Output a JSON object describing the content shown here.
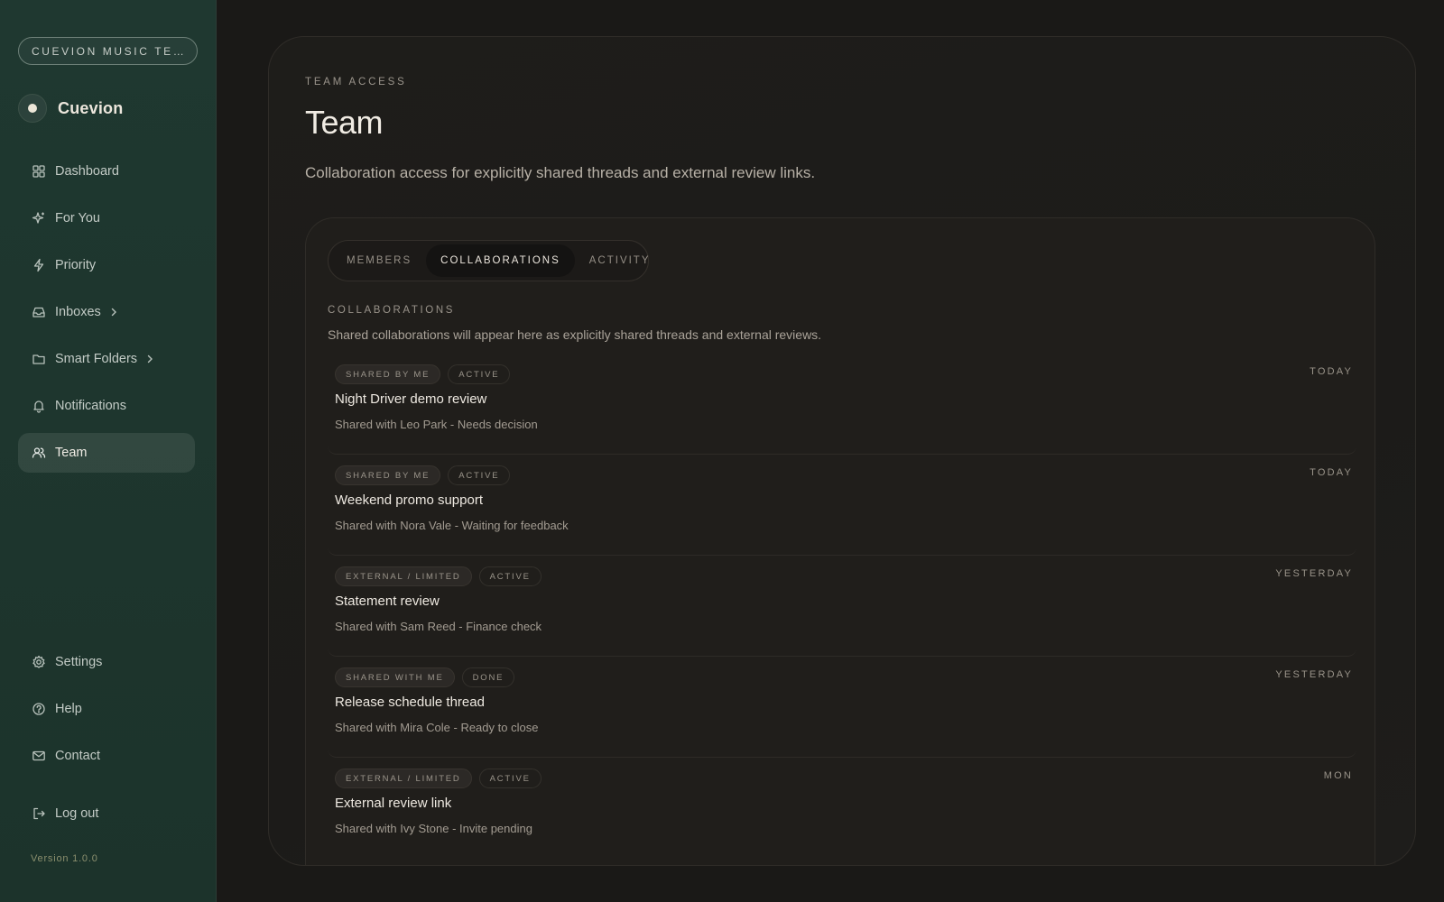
{
  "sidebar": {
    "workspace": "CUEVION MUSIC TEAM",
    "brand": "Cuevion",
    "nav": [
      {
        "label": "Dashboard",
        "icon": "grid-icon"
      },
      {
        "label": "For You",
        "icon": "sparkle-icon"
      },
      {
        "label": "Priority",
        "icon": "bolt-icon"
      },
      {
        "label": "Inboxes",
        "icon": "inbox-icon"
      },
      {
        "label": "Smart Folders",
        "icon": "folder-icon"
      },
      {
        "label": "Notifications",
        "icon": "bell-icon"
      },
      {
        "label": "Team",
        "icon": "users-icon"
      }
    ],
    "bottom_nav": [
      {
        "label": "Settings",
        "icon": "gear-icon"
      },
      {
        "label": "Help",
        "icon": "help-icon"
      },
      {
        "label": "Contact",
        "icon": "mail-icon"
      }
    ],
    "logout": "Log out",
    "version": "Version 1.0.0"
  },
  "page": {
    "eyebrow": "TEAM ACCESS",
    "title": "Team",
    "description": "Collaboration access for explicitly shared threads and external review links."
  },
  "tabs": [
    "MEMBERS",
    "COLLABORATIONS",
    "ACTIVITY"
  ],
  "section": {
    "eyebrow": "COLLABORATIONS",
    "description": "Shared collaborations will appear here as explicitly shared threads and external reviews."
  },
  "collaborations": [
    {
      "tags": [
        "SHARED BY ME",
        "ACTIVE"
      ],
      "title": "Night Driver demo review",
      "subtitle": "Shared with Leo Park - Needs decision",
      "date": "TODAY"
    },
    {
      "tags": [
        "SHARED BY ME",
        "ACTIVE"
      ],
      "title": "Weekend promo support",
      "subtitle": "Shared with Nora Vale - Waiting for feedback",
      "date": "TODAY"
    },
    {
      "tags": [
        "EXTERNAL / LIMITED",
        "ACTIVE"
      ],
      "title": "Statement review",
      "subtitle": "Shared with Sam Reed - Finance check",
      "date": "YESTERDAY"
    },
    {
      "tags": [
        "SHARED WITH ME",
        "DONE"
      ],
      "title": "Release schedule thread",
      "subtitle": "Shared with Mira Cole - Ready to close",
      "date": "YESTERDAY"
    },
    {
      "tags": [
        "EXTERNAL / LIMITED",
        "ACTIVE"
      ],
      "title": "External review link",
      "subtitle": "Shared with Ivy Stone - Invite pending",
      "date": "MON"
    }
  ]
}
